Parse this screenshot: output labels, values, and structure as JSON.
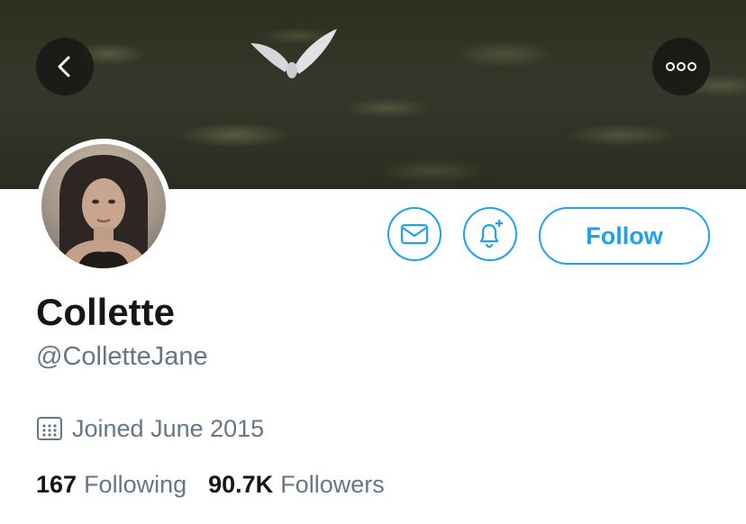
{
  "profile": {
    "name": "Collette",
    "handle": "@ColletteJane",
    "joined": "Joined June 2015"
  },
  "actions": {
    "follow_label": "Follow"
  },
  "stats": {
    "following_count": "167",
    "following_label": "Following",
    "followers_count": "90.7K",
    "followers_label": "Followers"
  },
  "icons": {
    "back": "chevron-left-icon",
    "more": "more-dots-icon",
    "message": "envelope-icon",
    "notify": "bell-plus-icon",
    "joined": "calendar-icon"
  },
  "colors": {
    "accent": "#1da1f2",
    "text_primary": "#14171a",
    "text_secondary": "#657786"
  }
}
